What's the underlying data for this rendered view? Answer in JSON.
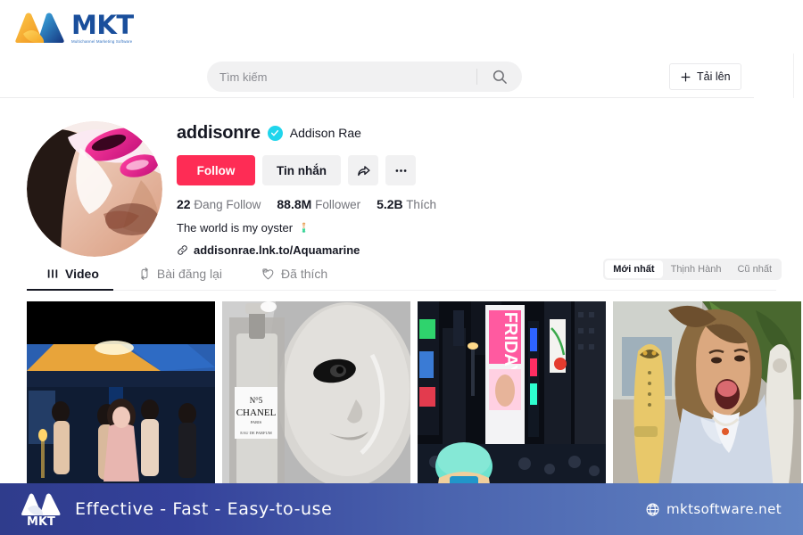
{
  "brand": {
    "name": "MKT",
    "tagline": "Multichannel Marketing Software"
  },
  "header": {
    "search_placeholder": "Tìm kiếm",
    "search_value": "",
    "search_icon": "search-icon",
    "upload_label": "Tải lên",
    "upload_icon": "plus-icon"
  },
  "profile": {
    "username": "addisonre",
    "verified_icon": "verified-check-icon",
    "display_name": "Addison Rae",
    "follow_label": "Follow",
    "message_label": "Tin nhắn",
    "share_icon": "share-arrow-icon",
    "more_icon": "ellipsis-icon",
    "stats": [
      {
        "value": "22",
        "label": "Đang Follow"
      },
      {
        "value": "88.8M",
        "label": "Follower"
      },
      {
        "value": "5.2B",
        "label": "Thích"
      }
    ],
    "bio": "The world is my oyster",
    "bio_emoji": "mermaid-emoji",
    "link_icon": "link-chain-icon",
    "link": "addisonrae.lnk.to/Aquamarine"
  },
  "tabs": [
    {
      "label": "Video",
      "icon": "grid-bars-icon",
      "active": true
    },
    {
      "label": "Bài đăng lại",
      "icon": "repost-arrows-icon",
      "active": false
    },
    {
      "label": "Đã thích",
      "icon": "heart-lock-icon",
      "active": false
    }
  ],
  "sort": [
    {
      "label": "Mới nhất",
      "active": true
    },
    {
      "label": "Thịnh Hành",
      "active": false
    },
    {
      "label": "Cũ nhất",
      "active": false
    }
  ],
  "videos": [
    {
      "name": "video-thumb-dance-party"
    },
    {
      "name": "video-thumb-chanel-mask"
    },
    {
      "name": "video-thumb-times-square"
    },
    {
      "name": "video-thumb-surfboards"
    }
  ],
  "footer": {
    "logo": "MKT",
    "slogan": "Effective - Fast - Easy-to-use",
    "globe_icon": "globe-icon",
    "site": "mktsoftware.net"
  },
  "colors": {
    "accent_follow": "#fe2c55",
    "verified": "#20d5ec",
    "brand_blue": "#1a4f9c",
    "brand_orange": "#f5a623",
    "footer_start": "#2f3c8c",
    "footer_end": "#6385c4"
  }
}
